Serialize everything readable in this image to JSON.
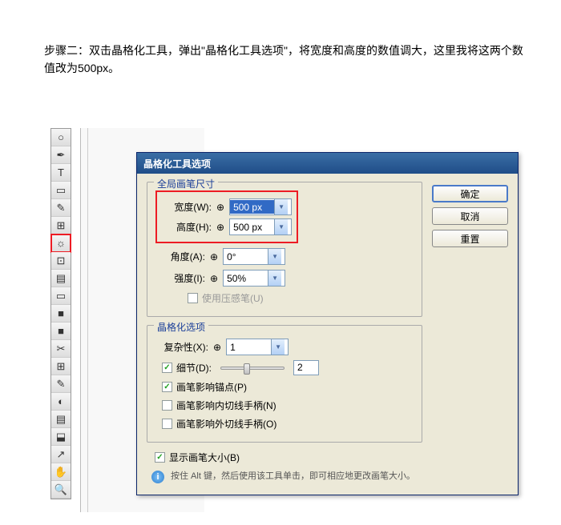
{
  "instruction": "步骤二：双击晶格化工具，弹出\"晶格化工具选项\"，将宽度和高度的数值调大，这里我将这两个数值改为500px。",
  "dialog": {
    "title": "晶格化工具选项",
    "brush_section": {
      "legend": "全局画笔尺寸",
      "width_label": "宽度(W):",
      "width_value": "500 px",
      "height_label": "高度(H):",
      "height_value": "500 px",
      "angle_label": "角度(A):",
      "angle_value": "0°",
      "intensity_label": "强度(I):",
      "intensity_value": "50%",
      "pressure_label": "使用压感笔(U)"
    },
    "options_section": {
      "legend": "晶格化选项",
      "complexity_label": "复杂性(X):",
      "complexity_value": "1",
      "detail_label": "细节(D):",
      "detail_value": "2",
      "anchor_label": "画笔影响锚点(P)",
      "in_handle_label": "画笔影响内切线手柄(N)",
      "out_handle_label": "画笔影响外切线手柄(O)"
    },
    "show_brush_label": "显示画笔大小(B)",
    "info_text": "按住 Alt 键，然后使用该工具单击，即可相应地更改画笔大小。",
    "buttons": {
      "ok": "确定",
      "cancel": "取消",
      "reset": "重置"
    }
  },
  "tools": [
    "○",
    "✎",
    "T",
    "▭",
    "◢",
    "⬚",
    "☀",
    "⊡",
    "≡",
    "⬚",
    "■",
    "■",
    "✂",
    "⊞",
    "✎",
    "◐",
    "▤",
    "⬓",
    "↗",
    "✋",
    "🔍"
  ]
}
